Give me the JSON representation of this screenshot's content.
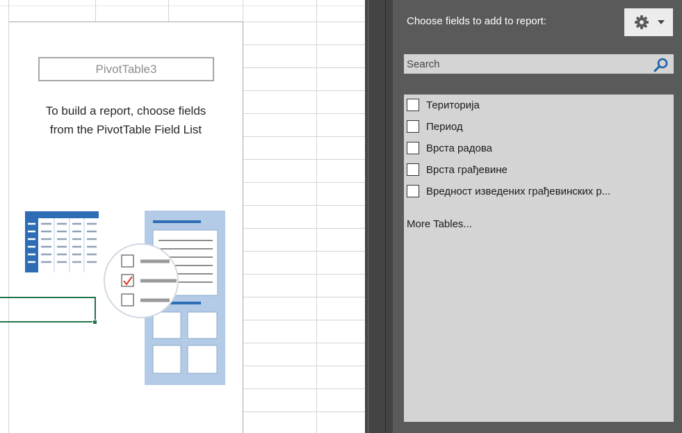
{
  "sheet": {
    "pivot_name": "PivotTable3",
    "instructions": "To build a report, choose fields\nfrom the PivotTable Field List"
  },
  "field_pane": {
    "title": "Choose fields to add to report:",
    "tools_icon": "gear-icon",
    "search_placeholder": "Search",
    "search_icon": "search-icon",
    "fields": [
      {
        "label": "Територија",
        "checked": false
      },
      {
        "label": "Период",
        "checked": false
      },
      {
        "label": "Врста радова",
        "checked": false
      },
      {
        "label": "Врста грађевине",
        "checked": false
      },
      {
        "label": "Вредност изведених грађевинских р...",
        "checked": false
      }
    ],
    "more_tables": "More Tables..."
  },
  "colors": {
    "pane_background": "#5a5a5a",
    "list_background": "#d4d4d4",
    "accent_blue": "#2e6db4",
    "selection_green": "#217346",
    "check_red": "#d9472b"
  }
}
